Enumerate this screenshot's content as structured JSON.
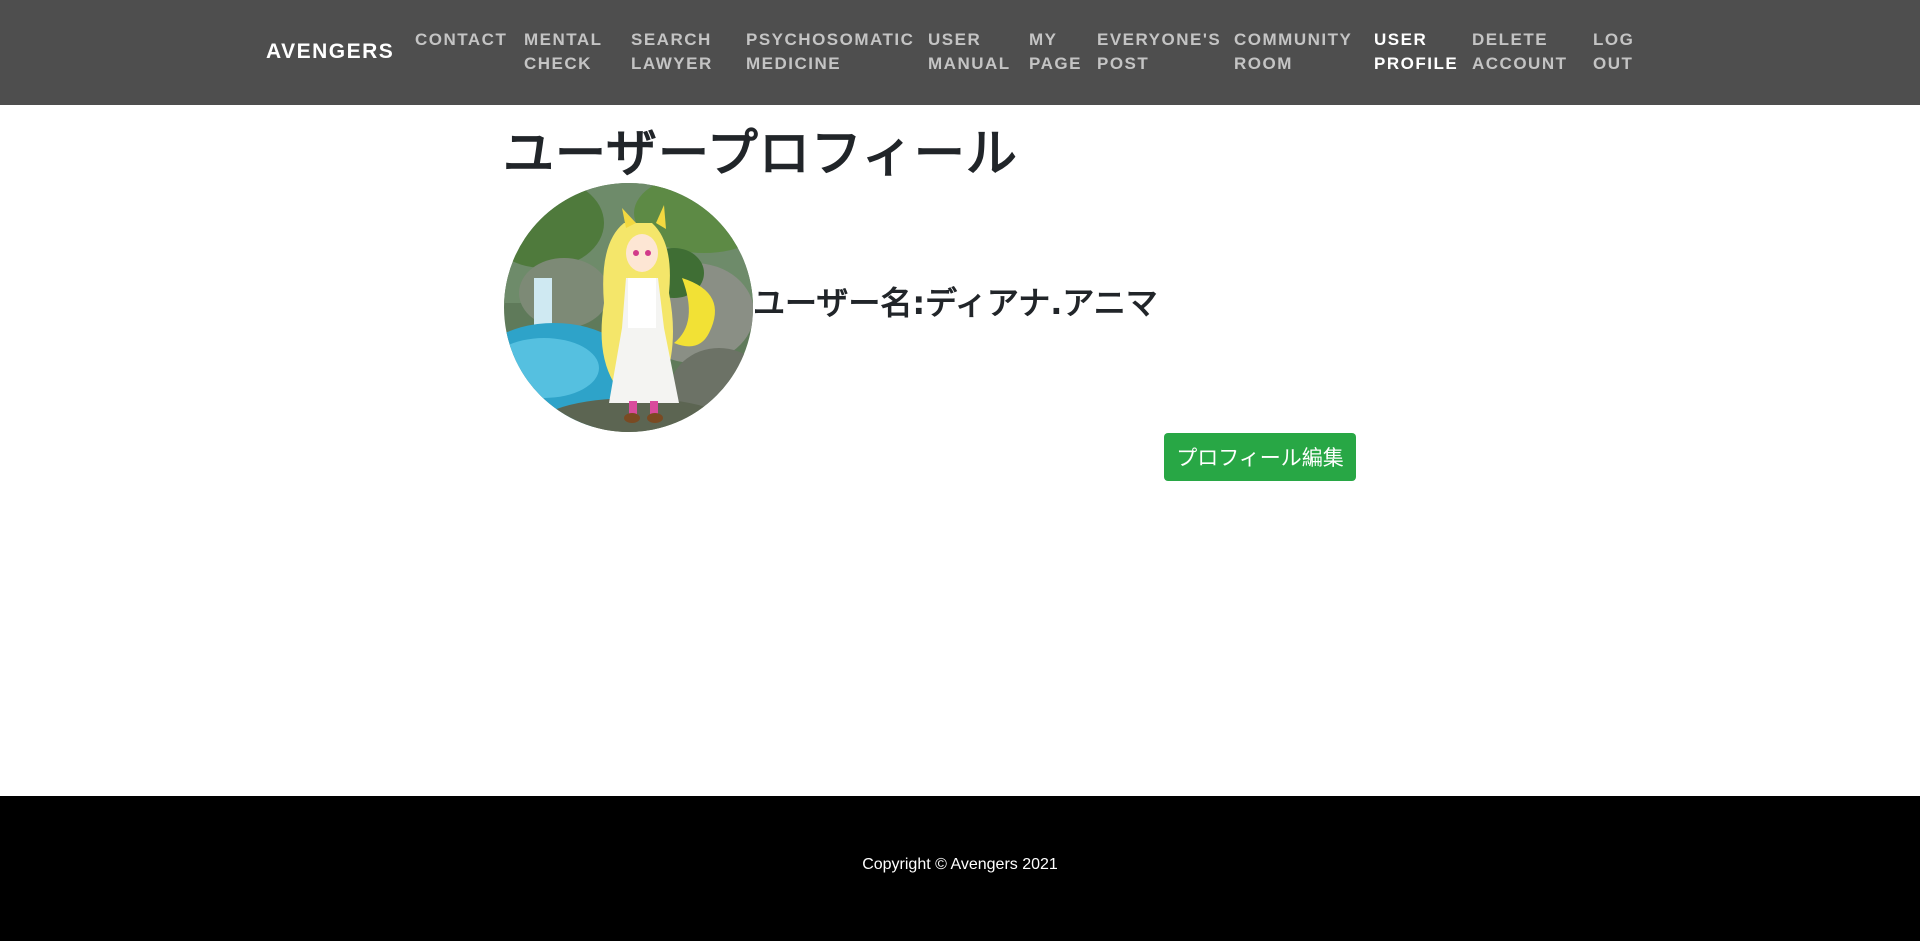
{
  "navbar": {
    "brand": "AVENGERS",
    "items": [
      {
        "line1": "CONTACT",
        "line2": ""
      },
      {
        "line1": "MENTAL",
        "line2": "CHECK"
      },
      {
        "line1": "SEARCH",
        "line2": "LAWYER"
      },
      {
        "line1": "PSYCHOSOMATIC",
        "line2": "MEDICINE"
      },
      {
        "line1": "USER",
        "line2": "MANUAL"
      },
      {
        "line1": "MY",
        "line2": "PAGE"
      },
      {
        "line1": "EVERYONE'S",
        "line2": "POST"
      },
      {
        "line1": "COMMUNITY",
        "line2": "ROOM"
      },
      {
        "line1": "USER",
        "line2": "PROFILE"
      },
      {
        "line1": "DELETE",
        "line2": "ACCOUNT"
      },
      {
        "line1": "LOG",
        "line2": "OUT"
      }
    ],
    "active_item": "USER PROFILE"
  },
  "main": {
    "title": "ユーザープロフィール",
    "username": "ユーザー名:ディアナ.アニマ",
    "edit_button_label": "プロフィール編集"
  },
  "footer": {
    "copyright": "Copyright © Avengers 2021"
  },
  "colors": {
    "navbar_bg": "#4e4e4e",
    "nav_text": "#c4c4c4",
    "nav_active": "#ffffff",
    "button_bg": "#28a745",
    "footer_bg": "#000000"
  }
}
